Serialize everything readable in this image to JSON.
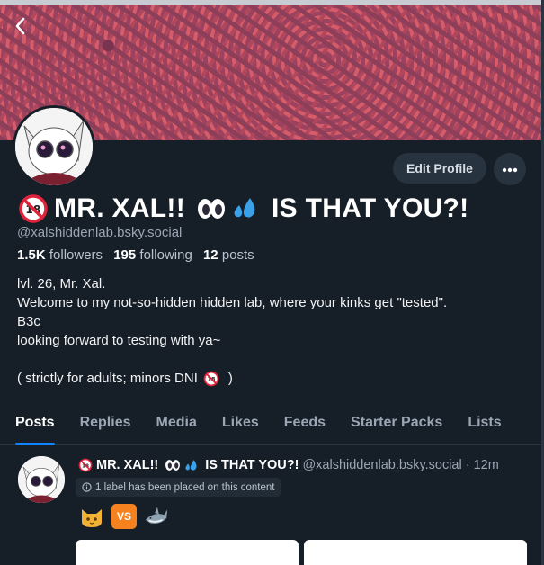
{
  "header": {
    "back_icon": "chevron-left-icon"
  },
  "profile": {
    "display_name_prefix_icon": "no-under-18-icon",
    "display_name_part1": "MR. XAL!!",
    "display_name_emoji1": "eyes-emoji-icon",
    "display_name_emoji2": "sweat-droplets-emoji-icon",
    "display_name_part2": "IS THAT YOU?!",
    "handle": "@xalshiddenlab.bsky.social",
    "followers_count": "1.5K",
    "followers_label": "followers",
    "following_count": "195",
    "following_label": "following",
    "posts_count": "12",
    "posts_label": "posts",
    "bio_lines": [
      "lvl. 26, Mr. Xal.",
      "Welcome to my not-so-hidden hidden lab, where your kinks get \"tested\".",
      "B3c",
      "looking forward to testing with ya~",
      "",
      "( strictly for adults; minors DNI"
    ],
    "bio_last_suffix": ")"
  },
  "actions": {
    "edit_profile_label": "Edit Profile",
    "more_icon": "ellipsis-icon"
  },
  "tabs": [
    {
      "label": "Posts",
      "active": true
    },
    {
      "label": "Replies",
      "active": false
    },
    {
      "label": "Media",
      "active": false
    },
    {
      "label": "Likes",
      "active": false
    },
    {
      "label": "Feeds",
      "active": false
    },
    {
      "label": "Starter Packs",
      "active": false
    },
    {
      "label": "Lists",
      "active": false
    }
  ],
  "post": {
    "author_name_part1": "MR. XAL!!",
    "author_name_part2": "IS THAT YOU?!",
    "author_handle": "@xalshiddenlab.bsky.social",
    "separator": "·",
    "time": "12m",
    "label_notice": "1 label has been placed on this content",
    "emojis": [
      "cat-face-emoji-icon",
      "vs-button-emoji-icon",
      "shark-emoji-icon"
    ],
    "vs_text": "VS"
  },
  "colors": {
    "background": "#161e27",
    "accent": "#1083fe",
    "muted_text": "#9aa6b4",
    "button_bg": "#27333f"
  }
}
